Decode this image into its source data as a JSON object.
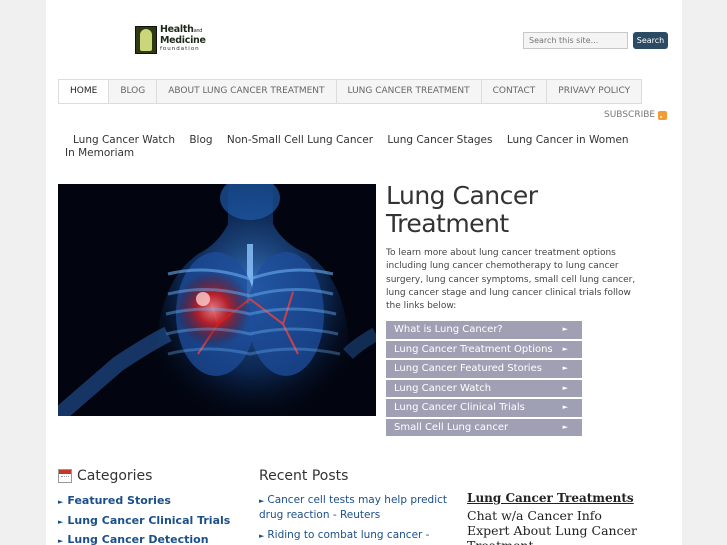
{
  "brand": {
    "line1": "Health",
    "line1_small": "and",
    "line2": "Medicine",
    "line3": "foundation"
  },
  "search": {
    "placeholder": "Search this site...",
    "button_label": "Search"
  },
  "main_nav": [
    {
      "label": "HOME"
    },
    {
      "label": "BLOG"
    },
    {
      "label": "ABOUT LUNG CANCER TREATMENT"
    },
    {
      "label": "LUNG CANCER TREATMENT"
    },
    {
      "label": "CONTACT"
    },
    {
      "label": "PRIVAVY POLICY"
    }
  ],
  "subscribe": {
    "label": "SUBSCRIBE",
    "icon": "rss-icon"
  },
  "sub_nav": [
    {
      "label": "Lung Cancer Watch"
    },
    {
      "label": "Blog"
    },
    {
      "label": "Non-Small Cell Lung Cancer"
    },
    {
      "label": "Lung Cancer Stages"
    },
    {
      "label": "Lung Cancer in Women"
    },
    {
      "label": "In Memoriam"
    }
  ],
  "hero": {
    "title": "Lung Cancer Treatment",
    "text": "To learn more about lung cancer treatment options including lung cancer chemotherapy to lung cancer surgery, lung cancer symptoms, small cell lung cancer, lung cancer stage and lung cancer clinical trials follow the links below:",
    "links": [
      {
        "label": "What is Lung Cancer?"
      },
      {
        "label": "Lung Cancer Treatment Options"
      },
      {
        "label": "Lung Cancer Featured Stories"
      },
      {
        "label": "Lung Cancer Watch"
      },
      {
        "label": "Lung Cancer Clinical Trials"
      },
      {
        "label": "Small Cell Lung cancer"
      }
    ],
    "arrow": "►"
  },
  "categories": {
    "title": "Categories",
    "items": [
      {
        "label": "Featured Stories"
      },
      {
        "label": "Lung Cancer Clinical Trials"
      },
      {
        "label": "Lung Cancer Detection"
      }
    ]
  },
  "recent_posts": {
    "title": "Recent Posts",
    "items": [
      {
        "label": "Cancer cell tests may help predict drug reaction - Reuters"
      },
      {
        "label": "Riding to combat lung cancer - WASH..."
      }
    ]
  },
  "widget": {
    "link": "Lung Cancer Treatments",
    "text": "Chat w/a Cancer Info Expert About Lung Cancer Treatment"
  },
  "bullet": "►",
  "colors": {
    "nav_button": "#2b4a63",
    "hero_link_bg": "#a0a0b4",
    "link": "#1a4f8a",
    "rss": "#f39c33"
  }
}
